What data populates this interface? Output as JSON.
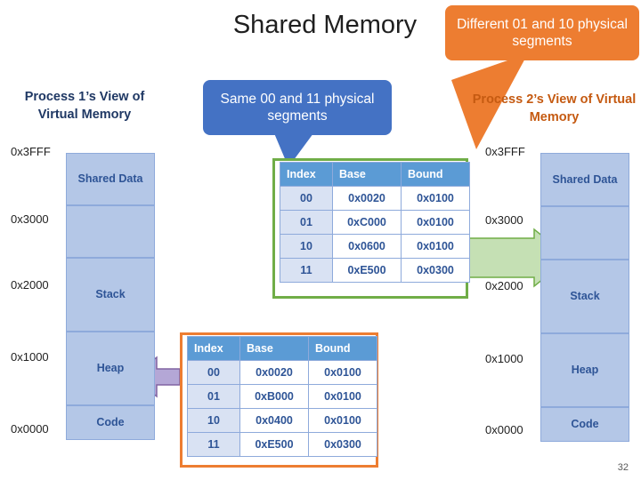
{
  "title": {
    "main": "Shared Memory"
  },
  "callouts": {
    "blue": "Same 00 and 11 physical segments",
    "orange": "Different 01 and 10 physical segments"
  },
  "process1": {
    "heading": "Process 1’s View of Virtual Memory",
    "addresses": [
      "0x3FFF",
      "0x3000",
      "0x2000",
      "0x1000",
      "0x0000"
    ],
    "segments": [
      {
        "label": "Shared Data"
      },
      {
        "label": ""
      },
      {
        "label": "Stack"
      },
      {
        "label": "Heap"
      },
      {
        "label": "Code"
      }
    ]
  },
  "process2": {
    "heading": "Process 2’s View of Virtual Memory",
    "addresses": [
      "0x3FFF",
      "0x3000",
      "0x2000",
      "0x1000",
      "0x0000"
    ],
    "segments": [
      {
        "label": "Shared Data"
      },
      {
        "label": ""
      },
      {
        "label": "Stack"
      },
      {
        "label": "Heap"
      },
      {
        "label": "Code"
      }
    ]
  },
  "table_top": {
    "headers": [
      "Index",
      "Base",
      "Bound"
    ],
    "rows": [
      {
        "index": "00",
        "base": "0x0020",
        "bound": "0x0100"
      },
      {
        "index": "01",
        "base": "0xC000",
        "bound": "0x0100"
      },
      {
        "index": "10",
        "base": "0x0600",
        "bound": "0x0100"
      },
      {
        "index": "11",
        "base": "0xE500",
        "bound": "0x0300"
      }
    ]
  },
  "table_bottom": {
    "headers": [
      "Index",
      "Base",
      "Bound"
    ],
    "rows": [
      {
        "index": "00",
        "base": "0x0020",
        "bound": "0x0100"
      },
      {
        "index": "01",
        "base": "0xB000",
        "bound": "0x0100"
      },
      {
        "index": "10",
        "base": "0x0400",
        "bound": "0x0100"
      },
      {
        "index": "11",
        "base": "0xE500",
        "bound": "0x0300"
      }
    ]
  },
  "footer": {
    "page_number": "32"
  },
  "colors": {
    "blue_callout": "#4472c4",
    "orange_callout": "#ed7d31",
    "segment_fill": "#b4c7e7",
    "table_header": "#5b9bd5",
    "green_border": "#70ad47",
    "orange_border": "#ed7d31"
  }
}
